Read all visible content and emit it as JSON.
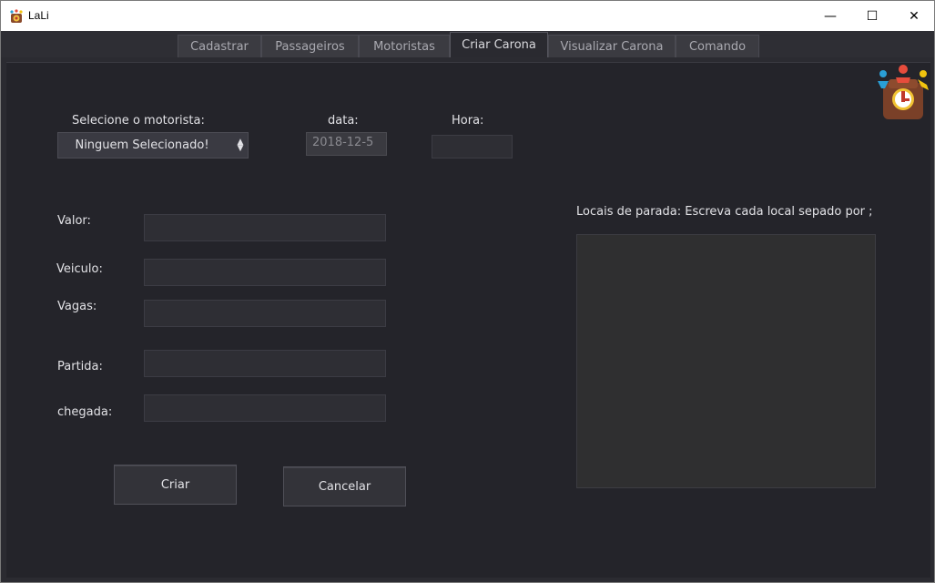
{
  "window": {
    "title": "LaLi",
    "minimize": "—",
    "maximize": "☐",
    "close": "✕"
  },
  "tabs": [
    {
      "label": "Cadastrar"
    },
    {
      "label": "Passageiros"
    },
    {
      "label": "Motoristas"
    },
    {
      "label": "Criar Carona",
      "active": true
    },
    {
      "label": "Visualizar Carona"
    },
    {
      "label": "Comando"
    }
  ],
  "form": {
    "driver_label": "Selecione o motorista:",
    "driver_selected": "Ninguem Selecionado!",
    "date_label": "data:",
    "date_value": "2018-12-5",
    "time_label": "Hora:",
    "time_value": "",
    "valor_label": "Valor:",
    "valor_value": "",
    "veiculo_label": "Veiculo:",
    "veiculo_value": "",
    "vagas_label": "Vagas:",
    "vagas_value": "",
    "partida_label": "Partida:",
    "partida_value": "",
    "chegada_label": "chegada:",
    "chegada_value": "",
    "stops_label": "Locais de parada: Escreva cada local sepado por ;",
    "stops_value": ""
  },
  "buttons": {
    "create": "Criar",
    "cancel": "Cancelar"
  },
  "colors": {
    "background": "#24242a",
    "accent": "#e2e2e6"
  }
}
